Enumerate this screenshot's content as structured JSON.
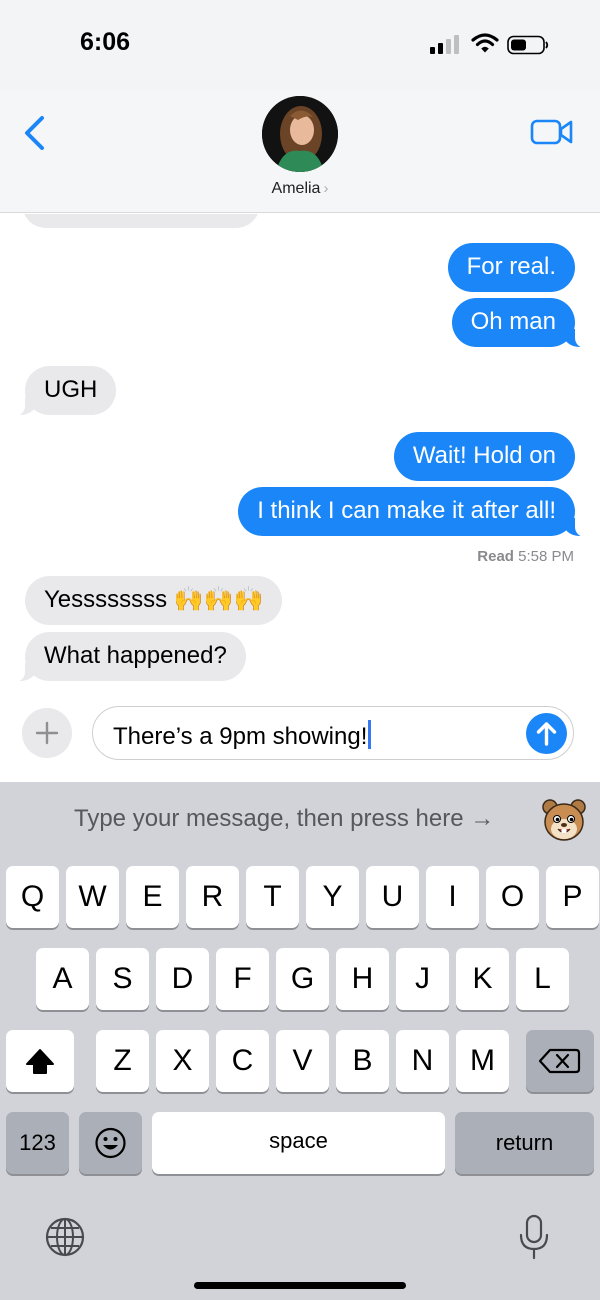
{
  "status_bar": {
    "time": "6:06"
  },
  "header": {
    "contact_name": "Amelia",
    "chevron": "›"
  },
  "messages": [
    {
      "direction": "outgoing",
      "text": "For real."
    },
    {
      "direction": "outgoing",
      "text": "Oh man"
    },
    {
      "direction": "incoming",
      "text": "UGH"
    },
    {
      "direction": "outgoing",
      "text": "Wait! Hold on"
    },
    {
      "direction": "outgoing",
      "text": "I think I can make it after all!"
    },
    {
      "direction": "incoming",
      "text": "Yessssssss 🙌🙌🙌"
    },
    {
      "direction": "incoming",
      "text": "What happened?"
    }
  ],
  "read_receipt": {
    "label": "Read",
    "time": "5:58 PM"
  },
  "composer": {
    "text": "There’s a 9pm showing!",
    "plus_symbol": "+"
  },
  "keyboard": {
    "suggestion": "Type your message, then press here →",
    "row1": [
      "Q",
      "W",
      "E",
      "R",
      "T",
      "Y",
      "U",
      "I",
      "O",
      "P"
    ],
    "row2": [
      "A",
      "S",
      "D",
      "F",
      "G",
      "H",
      "J",
      "K",
      "L"
    ],
    "row3": [
      "Z",
      "X",
      "C",
      "V",
      "B",
      "N",
      "M"
    ],
    "numbers_key": "123",
    "space_key": "space",
    "return_key": "return"
  },
  "colors": {
    "accent": "#1a86f7",
    "incoming_bubble": "#e9e9eb",
    "keyboard_bg": "#d1d3d9"
  },
  "icons": [
    "signal-icon",
    "wifi-icon",
    "battery-icon",
    "back-chevron-icon",
    "video-call-icon",
    "send-arrow-icon",
    "hamster-icon",
    "shift-icon",
    "delete-icon",
    "emoji-icon",
    "globe-icon",
    "microphone-icon"
  ]
}
